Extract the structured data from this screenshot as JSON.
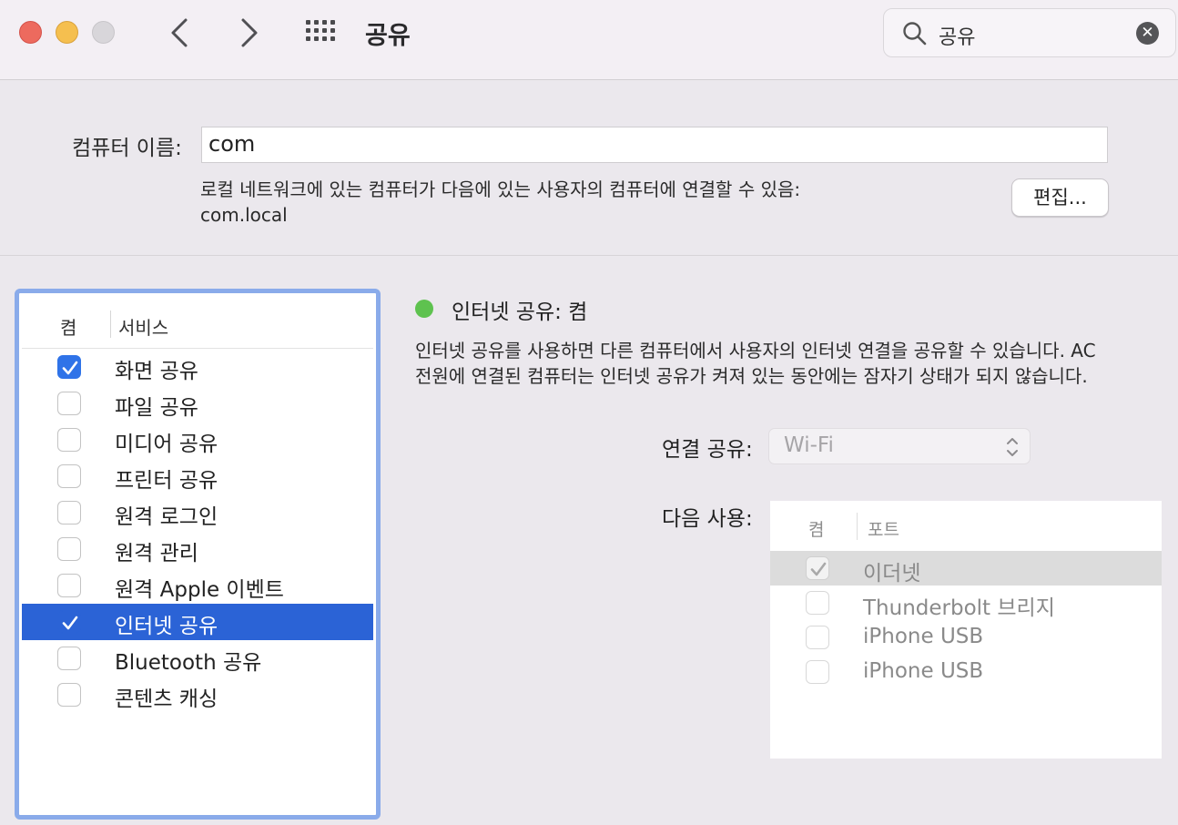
{
  "window": {
    "title": "공유"
  },
  "search": {
    "query": "공유"
  },
  "computer_name": {
    "label": "컴퓨터 이름:",
    "value": "com",
    "local_description": "로컬 네트워크에 있는 컴퓨터가 다음에 있는 사용자의 컴퓨터에 연결할 수 있음:",
    "local_address": "com.local",
    "edit_label": "편집..."
  },
  "services": {
    "header_on": "켬",
    "header_service": "서비스",
    "items": [
      {
        "label": "화면 공유",
        "checked": true,
        "selected": false
      },
      {
        "label": "파일 공유",
        "checked": false,
        "selected": false
      },
      {
        "label": "미디어 공유",
        "checked": false,
        "selected": false
      },
      {
        "label": "프린터 공유",
        "checked": false,
        "selected": false
      },
      {
        "label": "원격 로그인",
        "checked": false,
        "selected": false
      },
      {
        "label": "원격 관리",
        "checked": false,
        "selected": false
      },
      {
        "label": "원격 Apple 이벤트",
        "checked": false,
        "selected": false
      },
      {
        "label": "인터넷 공유",
        "checked": true,
        "selected": true
      },
      {
        "label": "Bluetooth 공유",
        "checked": false,
        "selected": false
      },
      {
        "label": "콘텐츠 캐싱",
        "checked": false,
        "selected": false
      }
    ]
  },
  "detail": {
    "status_title": "인터넷 공유: 켬",
    "status_color": "#5ec24f",
    "description_line1": "인터넷 공유를 사용하면 다른 컴퓨터에서 사용자의 인터넷 연결을 공유할 수 있습니다. AC",
    "description_line2": "전원에 연결된 컴퓨터는 인터넷 공유가 켜져 있는 동안에는 잠자기 상태가 되지 않습니다.",
    "connection_label": "연결 공유:",
    "connection_value": "Wi-Fi",
    "use_label": "다음 사용:",
    "ports_header_on": "켬",
    "ports_header_port": "포트",
    "ports": [
      {
        "label": "이더넷",
        "checked": true,
        "selected": true
      },
      {
        "label": "Thunderbolt 브리지",
        "checked": false,
        "selected": false
      },
      {
        "label": "iPhone USB",
        "checked": false,
        "selected": false
      },
      {
        "label": "iPhone USB",
        "checked": false,
        "selected": false
      }
    ]
  },
  "colors": {
    "accent": "#2b63d6",
    "list_focus_ring": "#8aabea"
  }
}
